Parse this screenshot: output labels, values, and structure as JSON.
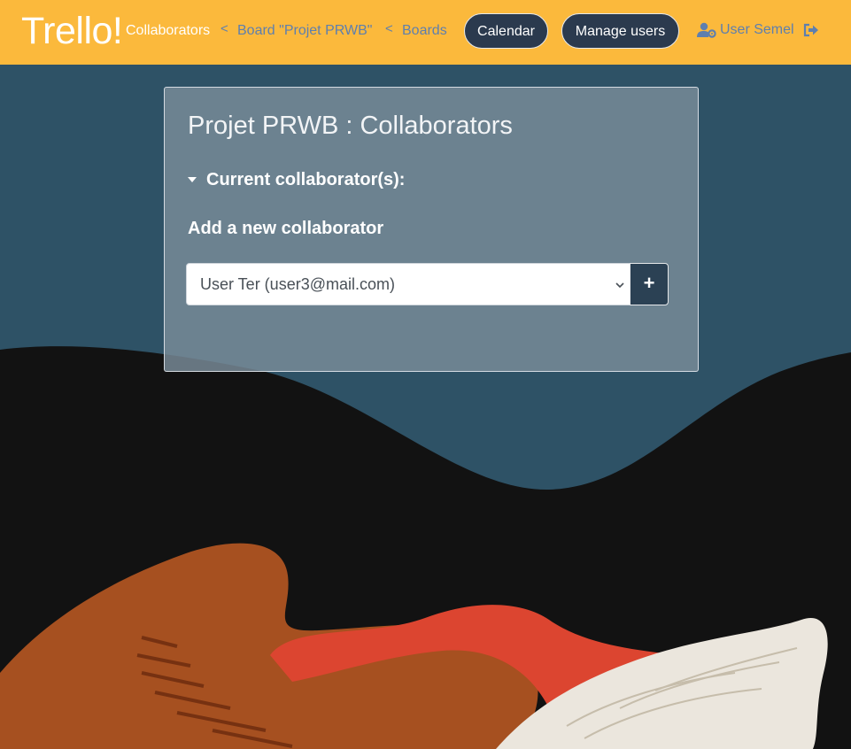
{
  "header": {
    "brand": "Trello!",
    "breadcrumb": {
      "current": "Collaborators",
      "separator": "<",
      "board_link": "Board \"Projet PRWB\"",
      "boards_link": "Boards"
    },
    "calendar_label": "Calendar",
    "manage_users_label": "Manage users",
    "user_name": "User Semel",
    "user_icon": "user-cog-icon",
    "logout_icon": "sign-out-icon"
  },
  "card": {
    "title": "Projet PRWB : Collaborators",
    "current_collaborators_label": "Current collaborator(s):",
    "add_heading": "Add a new collaborator",
    "select_value": "User Ter (user3@mail.com)",
    "add_button_label": "+"
  },
  "colors": {
    "navbar": "#fbb93c",
    "pill": "#2b3a4e",
    "link": "#5e7fae",
    "background": "#2e5266"
  }
}
